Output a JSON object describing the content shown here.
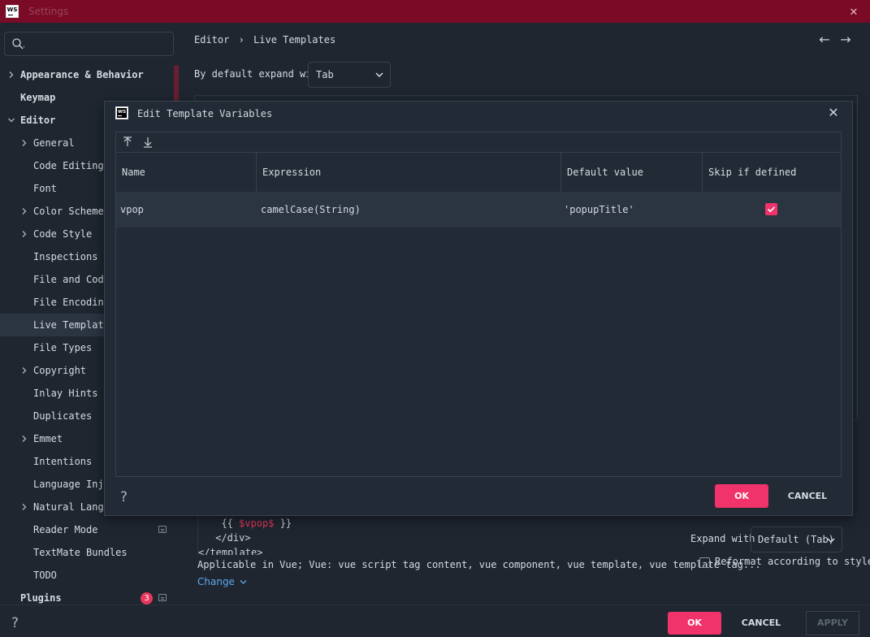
{
  "window": {
    "title": "Settings"
  },
  "sidebar": {
    "search_placeholder": "",
    "items": [
      {
        "label": "Appearance & Behavior",
        "expandable": true
      },
      {
        "label": "Keymap",
        "expandable": false
      },
      {
        "label": "Editor",
        "expandable": true,
        "expanded": true
      },
      {
        "label": "General",
        "expandable": true
      },
      {
        "label": "Code Editing",
        "expandable": false
      },
      {
        "label": "Font",
        "expandable": false
      },
      {
        "label": "Color Scheme",
        "expandable": true
      },
      {
        "label": "Code Style",
        "expandable": true
      },
      {
        "label": "Inspections",
        "expandable": false
      },
      {
        "label": "File and Code T",
        "expandable": false
      },
      {
        "label": "File Encodings",
        "expandable": false
      },
      {
        "label": "Live Templates",
        "expandable": false,
        "selected": true
      },
      {
        "label": "File Types",
        "expandable": false
      },
      {
        "label": "Copyright",
        "expandable": true
      },
      {
        "label": "Inlay Hints",
        "expandable": false
      },
      {
        "label": "Duplicates",
        "expandable": false
      },
      {
        "label": "Emmet",
        "expandable": true
      },
      {
        "label": "Intentions",
        "expandable": false
      },
      {
        "label": "Language Inject",
        "expandable": false
      },
      {
        "label": "Natural Languag",
        "expandable": true
      },
      {
        "label": "Reader Mode",
        "expandable": false
      },
      {
        "label": "TextMate Bundles",
        "expandable": false
      },
      {
        "label": "TODO",
        "expandable": false
      },
      {
        "label": "Plugins",
        "expandable": false
      }
    ],
    "plugins_badge": "3"
  },
  "main": {
    "breadcrumb_root": "Editor",
    "breadcrumb_sep": "›",
    "breadcrumb_page": "Live Templates",
    "expand_label": "By default expand with",
    "expand_value": "Tab",
    "code_lines": [
      {
        "prefix": "  {{ ",
        "var": "$vpop$",
        "suffix": " }}"
      },
      {
        "prefix": " </div>",
        "var": "",
        "suffix": ""
      },
      {
        "prefix": "</template>",
        "var": "",
        "suffix": ""
      }
    ],
    "applicable_text": "Applicable in Vue; Vue: vue script tag content, vue component, vue template, vue template tag...",
    "change_link": "Change",
    "expand_with_label": "Expand with",
    "expand_with_value": "Default (Tab)",
    "reformat_label": "Reformat according to style",
    "reformat_checked": false
  },
  "bottom": {
    "help": "?",
    "ok": "OK",
    "cancel": "CANCEL",
    "apply": "APPLY"
  },
  "dialog": {
    "title": "Edit Template Variables",
    "columns": [
      "Name",
      "Expression",
      "Default value",
      "Skip if defined"
    ],
    "rows": [
      {
        "name": "vpop",
        "expression": "camelCase(String)",
        "default_value": "'popupTitle'",
        "skip_if_defined": true
      }
    ],
    "help": "?",
    "ok": "OK",
    "cancel": "CANCEL"
  },
  "colors": {
    "accent": "#f0336a",
    "titlebar": "#7a0a26",
    "background": "#1f2630",
    "link": "#5fa8f0"
  },
  "icons": {
    "app_logo": "webstorm-logo-icon",
    "search": "search-icon",
    "move_up": "move-up-icon",
    "move_down": "move-down-icon",
    "back": "arrow-left-icon",
    "forward": "arrow-right-icon"
  }
}
